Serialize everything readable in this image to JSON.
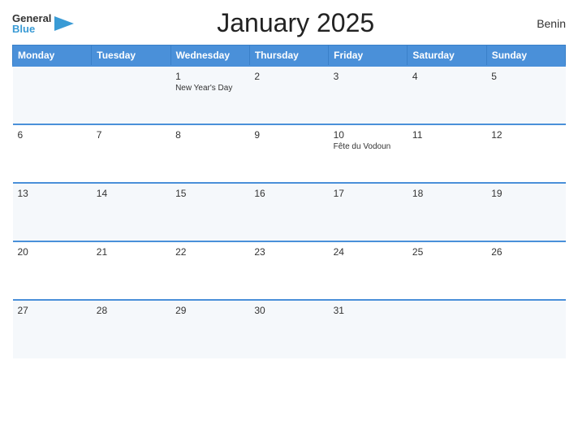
{
  "header": {
    "title": "January 2025",
    "country": "Benin",
    "logo_general": "General",
    "logo_blue": "Blue"
  },
  "weekdays": [
    "Monday",
    "Tuesday",
    "Wednesday",
    "Thursday",
    "Friday",
    "Saturday",
    "Sunday"
  ],
  "weeks": [
    [
      {
        "day": "",
        "event": ""
      },
      {
        "day": "",
        "event": ""
      },
      {
        "day": "1",
        "event": "New Year's Day"
      },
      {
        "day": "2",
        "event": ""
      },
      {
        "day": "3",
        "event": ""
      },
      {
        "day": "4",
        "event": ""
      },
      {
        "day": "5",
        "event": ""
      }
    ],
    [
      {
        "day": "6",
        "event": ""
      },
      {
        "day": "7",
        "event": ""
      },
      {
        "day": "8",
        "event": ""
      },
      {
        "day": "9",
        "event": ""
      },
      {
        "day": "10",
        "event": "Fête du Vodoun"
      },
      {
        "day": "11",
        "event": ""
      },
      {
        "day": "12",
        "event": ""
      }
    ],
    [
      {
        "day": "13",
        "event": ""
      },
      {
        "day": "14",
        "event": ""
      },
      {
        "day": "15",
        "event": ""
      },
      {
        "day": "16",
        "event": ""
      },
      {
        "day": "17",
        "event": ""
      },
      {
        "day": "18",
        "event": ""
      },
      {
        "day": "19",
        "event": ""
      }
    ],
    [
      {
        "day": "20",
        "event": ""
      },
      {
        "day": "21",
        "event": ""
      },
      {
        "day": "22",
        "event": ""
      },
      {
        "day": "23",
        "event": ""
      },
      {
        "day": "24",
        "event": ""
      },
      {
        "day": "25",
        "event": ""
      },
      {
        "day": "26",
        "event": ""
      }
    ],
    [
      {
        "day": "27",
        "event": ""
      },
      {
        "day": "28",
        "event": ""
      },
      {
        "day": "29",
        "event": ""
      },
      {
        "day": "30",
        "event": ""
      },
      {
        "day": "31",
        "event": ""
      },
      {
        "day": "",
        "event": ""
      },
      {
        "day": "",
        "event": ""
      }
    ]
  ]
}
